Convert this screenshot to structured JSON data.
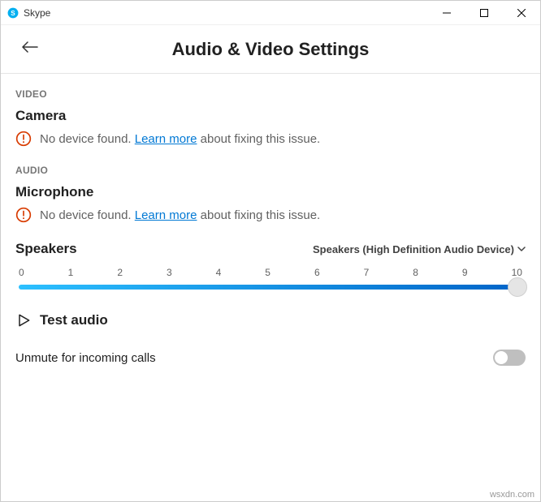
{
  "titlebar": {
    "app_name": "Skype"
  },
  "header": {
    "title": "Audio & Video Settings"
  },
  "video": {
    "section_label": "VIDEO",
    "heading": "Camera",
    "error_pre": "No device found. ",
    "learn_more": "Learn more",
    "error_post": " about fixing this issue."
  },
  "audio": {
    "section_label": "AUDIO",
    "heading": "Microphone",
    "error_pre": "No device found. ",
    "learn_more": "Learn more",
    "error_post": " about fixing this issue."
  },
  "speakers": {
    "label": "Speakers",
    "selected": "Speakers (High Definition Audio Device)",
    "ticks": [
      "0",
      "1",
      "2",
      "3",
      "4",
      "5",
      "6",
      "7",
      "8",
      "9",
      "10"
    ],
    "value": 10
  },
  "test": {
    "label": "Test audio"
  },
  "unmute": {
    "label": "Unmute for incoming calls",
    "on": false
  },
  "footer": "wsxdn.com"
}
